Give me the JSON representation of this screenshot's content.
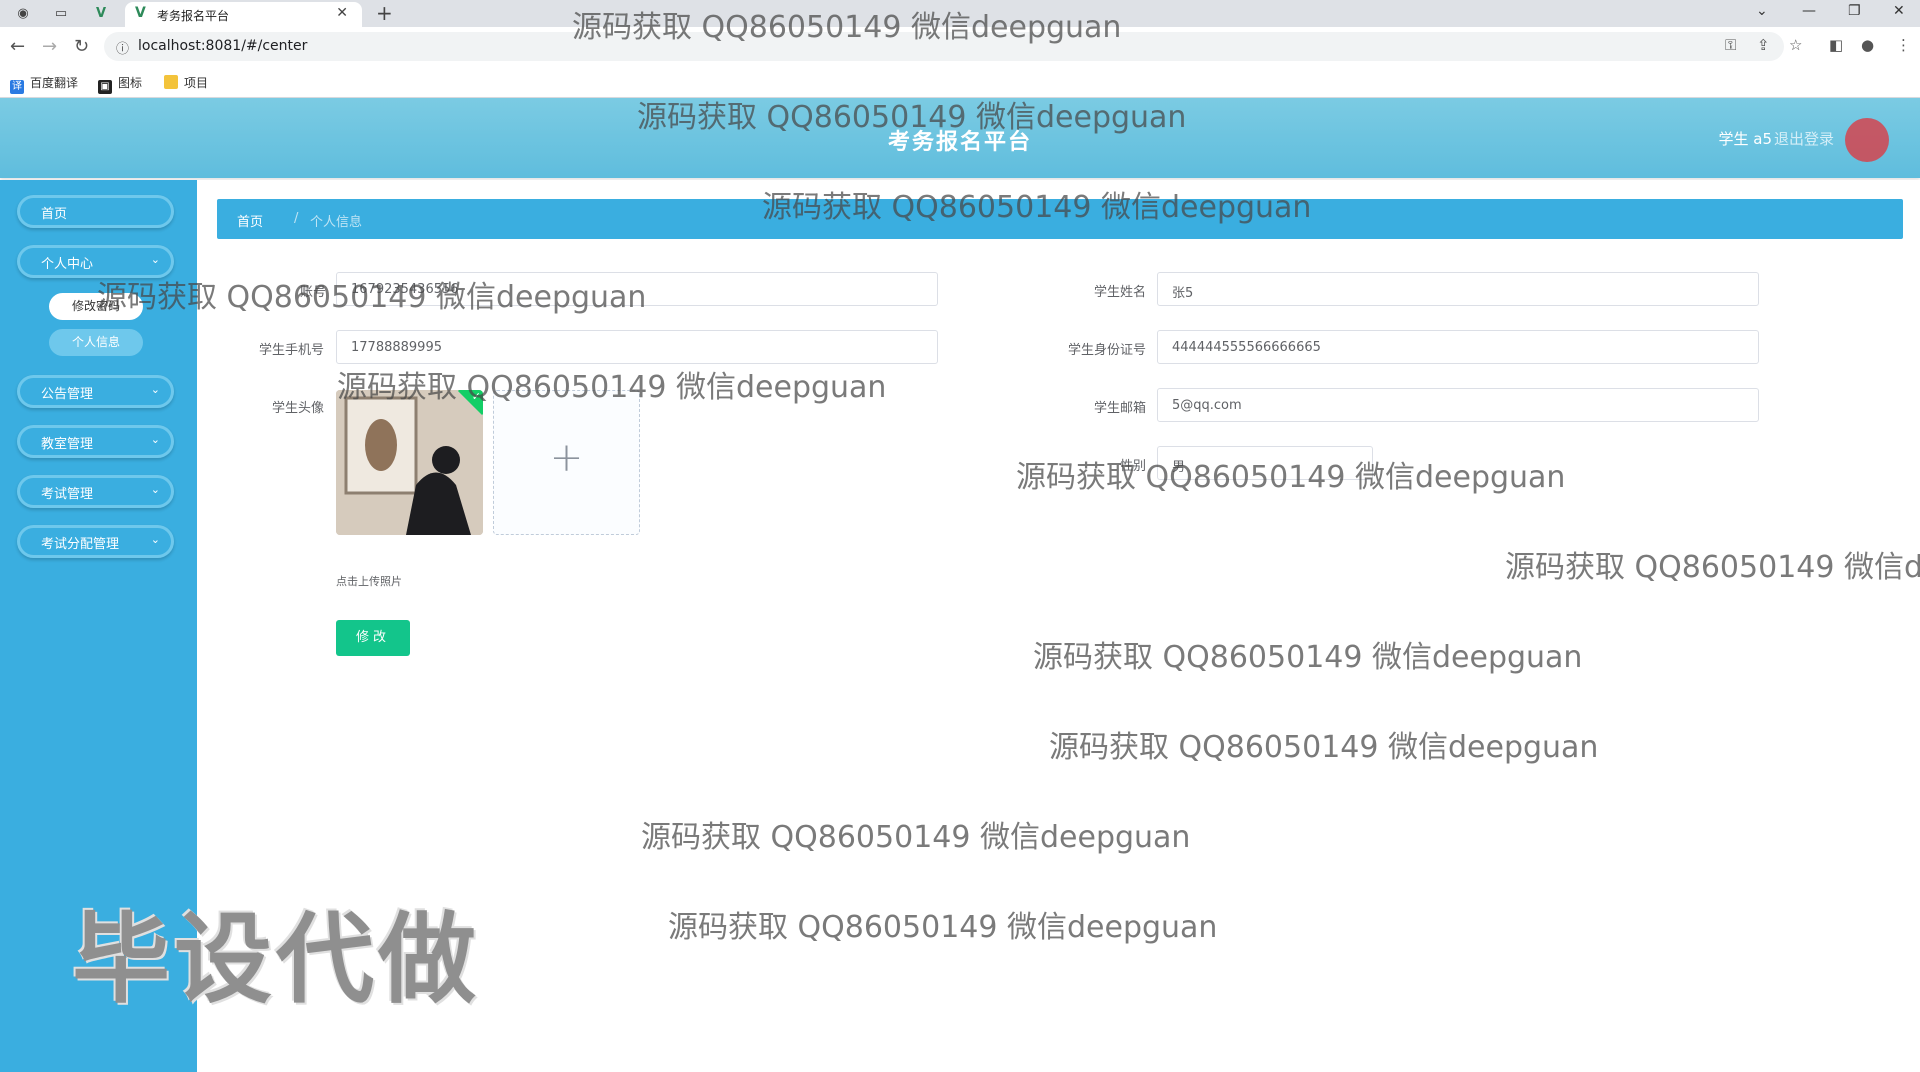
{
  "browser": {
    "tab_title": "考务报名平台",
    "url": "localhost:8081/#/center",
    "bookmarks": [
      "百度翻译",
      "图标",
      "项目"
    ]
  },
  "header": {
    "title": "考务报名平台",
    "user": "学生 a5",
    "logout": "退出登录"
  },
  "sidebar": {
    "items": [
      {
        "label": "首页",
        "has_arrow": false
      },
      {
        "label": "个人中心",
        "has_arrow": true
      },
      {
        "label": "公告管理",
        "has_arrow": true
      },
      {
        "label": "教室管理",
        "has_arrow": true
      },
      {
        "label": "考试管理",
        "has_arrow": true
      },
      {
        "label": "考试分配管理",
        "has_arrow": true
      }
    ],
    "sub_items": [
      "修改密码",
      "个人信息"
    ]
  },
  "breadcrumb": {
    "home": "首页",
    "sep": "/",
    "current": "个人信息"
  },
  "form": {
    "account_label": "账号",
    "account_value": "1679235436556",
    "student_name_label": "学生姓名",
    "student_name_value": "张5",
    "phone_label": "学生手机号",
    "phone_value": "17788889995",
    "id_card_label": "学生身份证号",
    "id_card_value": "444444555566666665",
    "avatar_label": "学生头像",
    "email_label": "学生邮箱",
    "email_value": "5@qq.com",
    "gender_label": "性别",
    "gender_value": "男",
    "upload_tip": "点击上传照片",
    "submit_label": "修改"
  },
  "watermarks": {
    "text": "源码获取 QQ86050149 微信deepguan",
    "big": "毕设代做"
  }
}
